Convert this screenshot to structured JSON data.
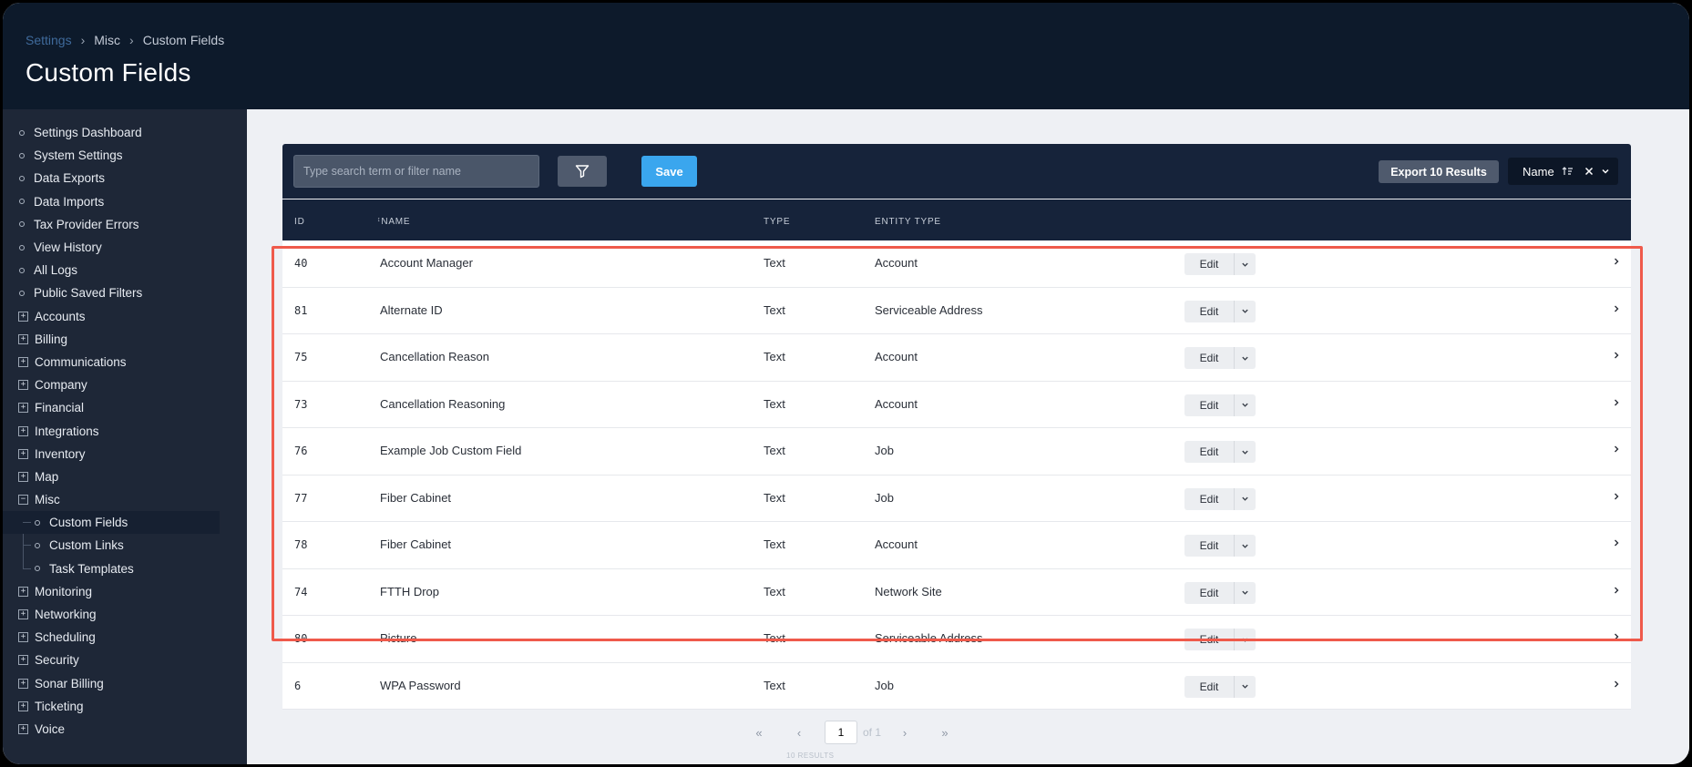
{
  "breadcrumb": {
    "root": "Settings",
    "parent": "Misc",
    "current": "Custom Fields"
  },
  "page": {
    "title": "Custom Fields"
  },
  "sidebar": {
    "items": [
      {
        "label": "Settings Dashboard",
        "kind": "link"
      },
      {
        "label": "System Settings",
        "kind": "link"
      },
      {
        "label": "Data Exports",
        "kind": "link"
      },
      {
        "label": "Data Imports",
        "kind": "link"
      },
      {
        "label": "Tax Provider Errors",
        "kind": "link"
      },
      {
        "label": "View History",
        "kind": "link"
      },
      {
        "label": "All Logs",
        "kind": "link"
      },
      {
        "label": "Public Saved Filters",
        "kind": "link"
      },
      {
        "label": "Accounts",
        "kind": "group"
      },
      {
        "label": "Billing",
        "kind": "group"
      },
      {
        "label": "Communications",
        "kind": "group"
      },
      {
        "label": "Company",
        "kind": "group"
      },
      {
        "label": "Financial",
        "kind": "group"
      },
      {
        "label": "Integrations",
        "kind": "group"
      },
      {
        "label": "Inventory",
        "kind": "group"
      },
      {
        "label": "Map",
        "kind": "group"
      }
    ],
    "misc": {
      "label": "Misc",
      "children": [
        {
          "label": "Custom Fields",
          "active": true
        },
        {
          "label": "Custom Links"
        },
        {
          "label": "Task Templates"
        }
      ]
    },
    "items_after": [
      {
        "label": "Monitoring"
      },
      {
        "label": "Networking"
      },
      {
        "label": "Scheduling"
      },
      {
        "label": "Security"
      },
      {
        "label": "Sonar Billing"
      },
      {
        "label": "Ticketing"
      },
      {
        "label": "Voice"
      }
    ]
  },
  "toolbar": {
    "search_placeholder": "Type search term or filter name",
    "save_label": "Save",
    "export_label": "Export 10 Results",
    "sort_label": "Name"
  },
  "table": {
    "columns": {
      "id": "ID",
      "name": "NAME",
      "type": "TYPE",
      "entity": "ENTITY TYPE"
    },
    "edit_label": "Edit",
    "rows": [
      {
        "id": "40",
        "name": "Account Manager",
        "type": "Text",
        "entity": "Account"
      },
      {
        "id": "81",
        "name": "Alternate ID",
        "type": "Text",
        "entity": "Serviceable Address"
      },
      {
        "id": "75",
        "name": "Cancellation Reason",
        "type": "Text",
        "entity": "Account"
      },
      {
        "id": "73",
        "name": "Cancellation Reasoning",
        "type": "Text",
        "entity": "Account"
      },
      {
        "id": "76",
        "name": "Example Job Custom Field",
        "type": "Text",
        "entity": "Job"
      },
      {
        "id": "77",
        "name": "Fiber Cabinet",
        "type": "Text",
        "entity": "Job"
      },
      {
        "id": "78",
        "name": "Fiber Cabinet",
        "type": "Text",
        "entity": "Account"
      },
      {
        "id": "74",
        "name": "FTTH Drop",
        "type": "Text",
        "entity": "Network Site"
      },
      {
        "id": "80",
        "name": "Picture",
        "type": "Text",
        "entity": "Serviceable Address"
      },
      {
        "id": "6",
        "name": "WPA Password",
        "type": "Text",
        "entity": "Job"
      }
    ]
  },
  "pagination": {
    "first": "«",
    "prev": "‹",
    "next": "›",
    "last": "»",
    "page_value": "1",
    "of_text": "of 1",
    "results_text": "10 RESULTS"
  },
  "colors": {
    "header_bg": "#0d1a2b",
    "sidebar_bg": "#1e2737",
    "accent": "#3aa6ee",
    "highlight": "#ef5a4b"
  }
}
